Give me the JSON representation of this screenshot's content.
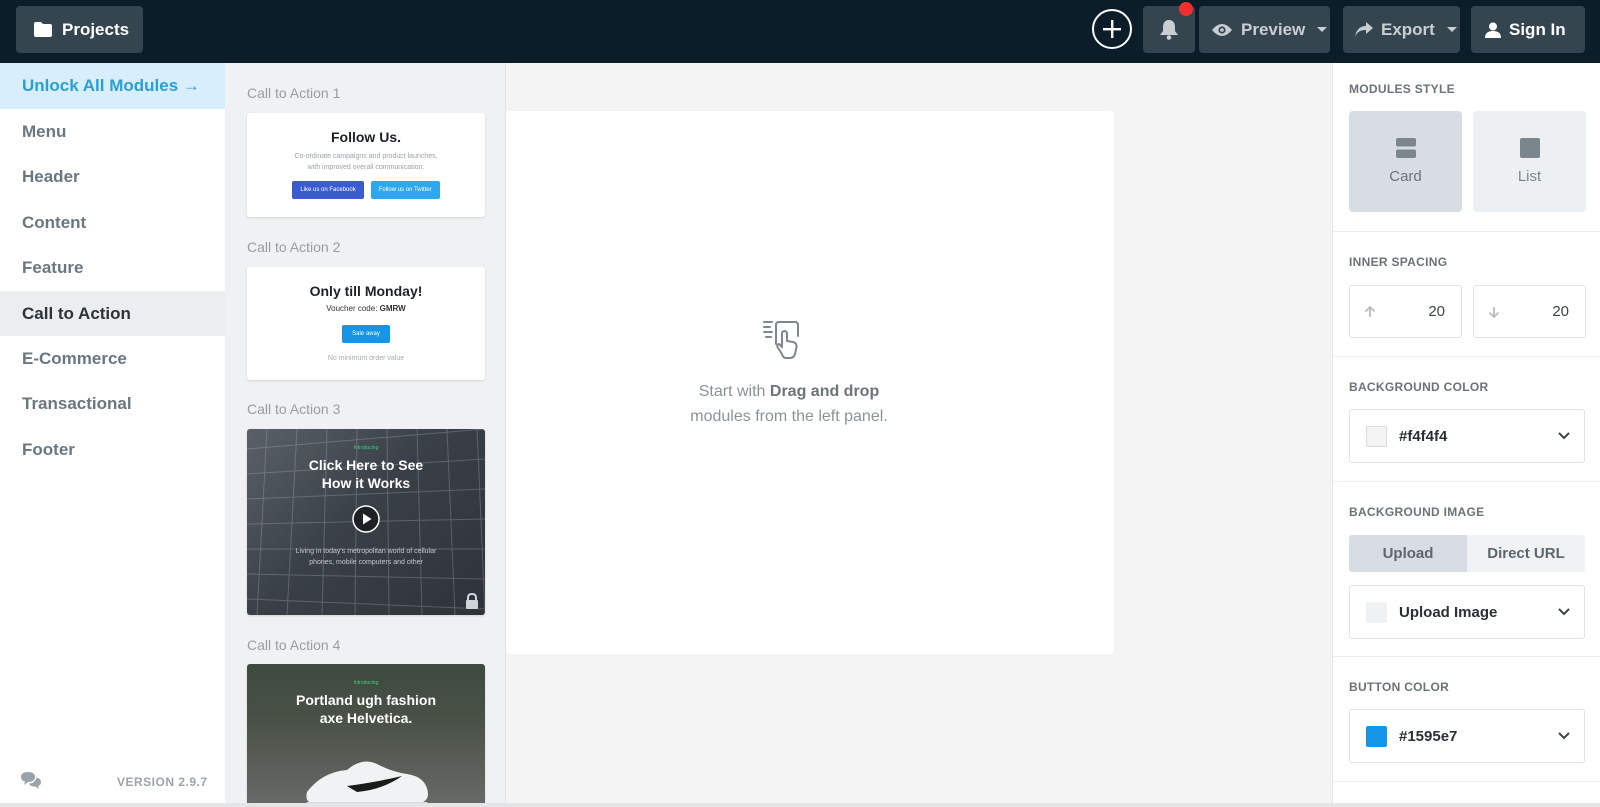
{
  "topbar": {
    "projects_label": "Projects",
    "preview_label": "Preview",
    "export_label": "Export",
    "signin_label": "Sign In"
  },
  "leftnav": {
    "unlock_label": "Unlock All Modules →",
    "items": [
      {
        "label": "Menu"
      },
      {
        "label": "Header"
      },
      {
        "label": "Content"
      },
      {
        "label": "Feature"
      },
      {
        "label": "Call to Action"
      },
      {
        "label": "E-Commerce"
      },
      {
        "label": "Transactional"
      },
      {
        "label": "Footer"
      }
    ],
    "active_item": "Call to Action",
    "version": "VERSION 2.9.7"
  },
  "modules": {
    "cards": [
      {
        "title": "Call to Action 1",
        "heading": "Follow Us.",
        "body_line1": "Co-ordinate campaigns and product launches,",
        "body_line2": "with improved overall communication.",
        "button1": "Like us on Facebook",
        "button2": "Follow us on Twitter"
      },
      {
        "title": "Call to Action 2",
        "heading": "Only till Monday!",
        "voucher_prefix": "Voucher code:",
        "voucher_code": "GMRW",
        "button": "Sale away",
        "note": "No minimum order value"
      },
      {
        "title": "Call to Action 3",
        "tag": "Introducing",
        "heading_line1": "Click Here to See",
        "heading_line2": "How it Works",
        "body_line1": "Living in today's metropolitan world of cellular",
        "body_line2": "phones, mobile computers and other"
      },
      {
        "title": "Call to Action 4",
        "tag": "Introducing",
        "heading_line1": "Portland ugh fashion",
        "heading_line2": "axe Helvetica."
      }
    ]
  },
  "canvas": {
    "start_prefix": "Start with",
    "start_bold": "Drag and drop",
    "start_line2": "modules from the left panel."
  },
  "rightpanel": {
    "modules_style_label": "MODULES STYLE",
    "style_card": "Card",
    "style_list": "List",
    "inner_spacing_label": "INNER SPACING",
    "spacing_top": "20",
    "spacing_bottom": "20",
    "bg_color_label": "BACKGROUND COLOR",
    "bg_color_value": "#f4f4f4",
    "bg_image_label": "BACKGROUND IMAGE",
    "bg_image_tab_upload": "Upload",
    "bg_image_tab_url": "Direct URL",
    "upload_image_label": "Upload Image",
    "button_color_label": "BUTTON COLOR",
    "button_color_value": "#1595e7"
  },
  "colors": {
    "topbar_bg": "#0b1d28",
    "accent": "#2a9fd8",
    "button_color": "#1595e7",
    "notification": "#f0302f"
  }
}
